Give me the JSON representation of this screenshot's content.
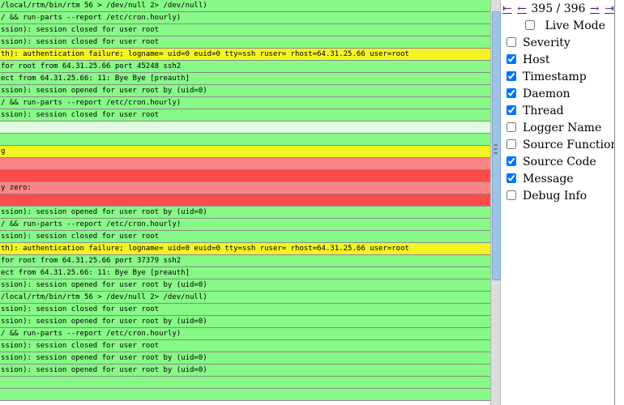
{
  "colors": {
    "green": "#86f986",
    "light_green": "#e0fce0",
    "yellow": "#f4f422",
    "light_red": "#fb8686",
    "red": "#fb4b4b"
  },
  "log_rows": [
    {
      "text": "/local/rtm/bin/rtm 56 > /dev/null 2> /dev/null)",
      "color": "#86f986"
    },
    {
      "text": "/ && run-parts --report /etc/cron.hourly)",
      "color": "#86f986"
    },
    {
      "text": "ssion): session closed for user root",
      "color": "#86f986"
    },
    {
      "text": "ssion): session closed for user root",
      "color": "#86f986"
    },
    {
      "text": "th): authentication failure; logname= uid=0 euid=0 tty=ssh ruser= rhost=64.31.25.66 user=root",
      "color": "#f4f422"
    },
    {
      "text": "for root from 64.31.25.66 port 45248 ssh2",
      "color": "#86f986"
    },
    {
      "text": "ect from 64.31.25.66: 11: Bye Bye [preauth]",
      "color": "#86f986"
    },
    {
      "text": "ssion): session opened for user root by (uid=0)",
      "color": "#86f986"
    },
    {
      "text": "/ && run-parts --report /etc/cron.hourly)",
      "color": "#86f986"
    },
    {
      "text": "ssion): session closed for user root",
      "color": "#86f986"
    },
    {
      "text": "",
      "color": "#e0fce0"
    },
    {
      "text": "",
      "color": "#86f986"
    },
    {
      "text": "g",
      "color": "#f4f422"
    },
    {
      "text": "",
      "color": "#fb8686"
    },
    {
      "text": "",
      "color": "#fb4b4b"
    },
    {
      "text": "y zero:",
      "color": "#fb8686"
    },
    {
      "text": "",
      "color": "#fb4b4b"
    },
    {
      "text": "ssion): session opened for user root by (uid=0)",
      "color": "#86f986"
    },
    {
      "text": "/ && run-parts --report /etc/cron.hourly)",
      "color": "#86f986"
    },
    {
      "text": "ssion): session closed for user root",
      "color": "#86f986"
    },
    {
      "text": "th): authentication failure; logname= uid=0 euid=0 tty=ssh ruser= rhost=64.31.25.66 user=root",
      "color": "#f4f422"
    },
    {
      "text": "for root from 64.31.25.66 port 37379 ssh2",
      "color": "#86f986"
    },
    {
      "text": "ect from 64.31.25.66: 11: Bye Bye [preauth]",
      "color": "#86f986"
    },
    {
      "text": "ssion): session opened for user root by (uid=0)",
      "color": "#86f986"
    },
    {
      "text": "/local/rtm/bin/rtm 56 > /dev/null 2> /dev/null)",
      "color": "#86f986"
    },
    {
      "text": "ssion): session closed for user root",
      "color": "#86f986"
    },
    {
      "text": "ssion): session opened for user root by (uid=0)",
      "color": "#86f986"
    },
    {
      "text": "/ && run-parts --report /etc/cron.hourly)",
      "color": "#86f986"
    },
    {
      "text": "ssion): session closed for user root",
      "color": "#86f986"
    },
    {
      "text": "ssion): session opened for user root by (uid=0)",
      "color": "#86f986"
    },
    {
      "text": "ssion): session opened for user root by (uid=0)",
      "color": "#86f986"
    },
    {
      "text": "",
      "color": "#86f986"
    },
    {
      "text": "",
      "color": "#86f986"
    }
  ],
  "nav": {
    "first": "⇤",
    "prev": "←",
    "position": "395 / 396",
    "next": "→",
    "last": "⇥"
  },
  "live_mode": {
    "label": "Live Mode",
    "checked": false
  },
  "options": [
    {
      "label": "Severity",
      "checked": false
    },
    {
      "label": "Host",
      "checked": true
    },
    {
      "label": "Timestamp",
      "checked": true
    },
    {
      "label": "Daemon",
      "checked": true
    },
    {
      "label": "Thread",
      "checked": true
    },
    {
      "label": "Logger Name",
      "checked": false
    },
    {
      "label": "Source Function",
      "checked": false
    },
    {
      "label": "Source Code",
      "checked": true
    },
    {
      "label": "Message",
      "checked": true
    },
    {
      "label": "Debug Info",
      "checked": false
    }
  ]
}
